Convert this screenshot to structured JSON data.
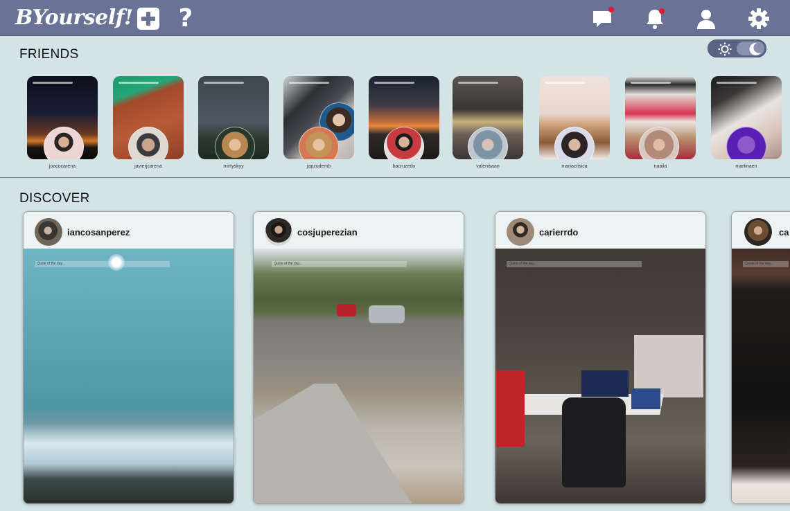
{
  "app": {
    "logo": "BYourself!"
  },
  "header": {
    "icons": [
      "plus-icon",
      "help-icon",
      "chat-icon",
      "bell-icon",
      "user-icon",
      "gear-icon"
    ],
    "notification_color": "#e8142b",
    "background": "#6a7295"
  },
  "friends": {
    "title": "FRIENDS",
    "items": [
      {
        "username": "joacocarena"
      },
      {
        "username": "javierjcarena"
      },
      {
        "username": "mirtyskyy"
      },
      {
        "username": "japzudemb"
      },
      {
        "username": "bacruzedo"
      },
      {
        "username": "valenisaan"
      },
      {
        "username": "mariacrisica"
      },
      {
        "username": "naaila"
      },
      {
        "username": "martinaen"
      }
    ]
  },
  "discover": {
    "title": "DISCOVER",
    "posts": [
      {
        "username": "iancosanperez",
        "quote": "Quote of the day..."
      },
      {
        "username": "cosjuperezian",
        "quote": "Quote of the day..."
      },
      {
        "username": "carierrdo",
        "quote": "Quote of the day..."
      },
      {
        "username": "ca",
        "quote": "Quote of the day..."
      }
    ]
  },
  "theme_toggle": {
    "icons": [
      "sun-icon",
      "moon-icon"
    ]
  }
}
